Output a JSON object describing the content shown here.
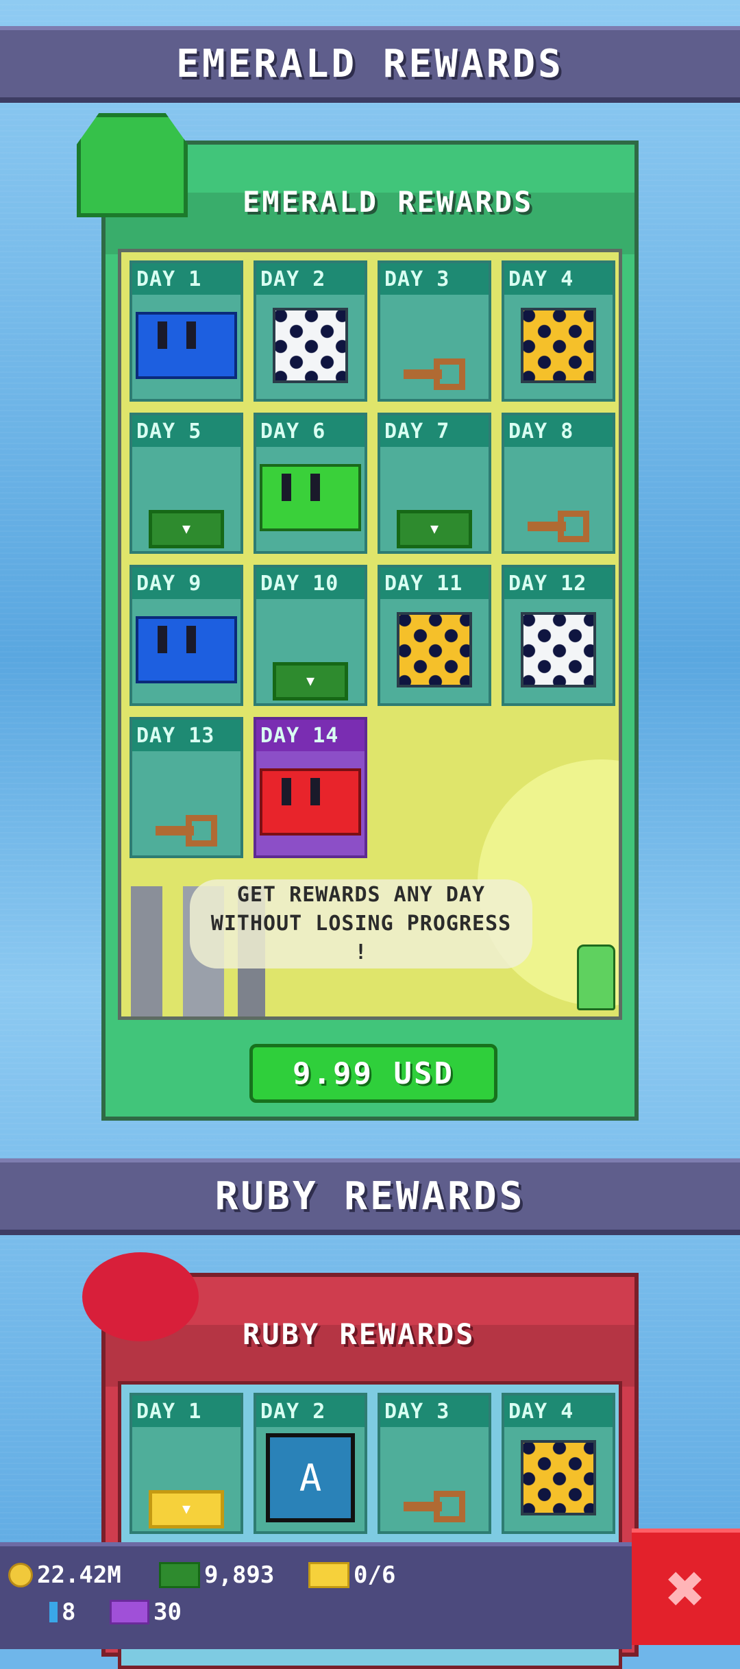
{
  "emerald_section": {
    "banner": "EMERALD REWARDS",
    "title": "EMERALD REWARDS",
    "days": [
      {
        "label": "DAY 1",
        "item": "blue-chest"
      },
      {
        "label": "DAY 2",
        "item": "white-dice"
      },
      {
        "label": "DAY 3",
        "item": "key"
      },
      {
        "label": "DAY 4",
        "item": "gold-dice"
      },
      {
        "label": "DAY 5",
        "item": "cash"
      },
      {
        "label": "DAY 6",
        "item": "green-chest"
      },
      {
        "label": "DAY 7",
        "item": "cash"
      },
      {
        "label": "DAY 8",
        "item": "key"
      },
      {
        "label": "DAY 9",
        "item": "blue-chest"
      },
      {
        "label": "DAY 10",
        "item": "cash"
      },
      {
        "label": "DAY 11",
        "item": "gold-dice"
      },
      {
        "label": "DAY 12",
        "item": "white-dice"
      },
      {
        "label": "DAY 13",
        "item": "key"
      },
      {
        "label": "DAY 14",
        "item": "red-chest"
      }
    ],
    "message": "GET REWARDS ANY DAY WITHOUT LOSING PROGRESS !",
    "price": "9.99 USD"
  },
  "ruby_section": {
    "banner": "RUBY REWARDS",
    "title": "RUBY REWARDS",
    "days": [
      {
        "label": "DAY 1",
        "item": "gold-cash"
      },
      {
        "label": "DAY 2",
        "item": "card"
      },
      {
        "label": "DAY 3",
        "item": "key"
      },
      {
        "label": "DAY 4",
        "item": "gold-dice"
      }
    ],
    "card_glyph": "A"
  },
  "hud": {
    "coins": "22.42M",
    "cash": "9,893",
    "gold_tickets": "0/6",
    "gems": "8",
    "tickets": "30"
  },
  "close_glyph": "✖",
  "colors": {
    "emerald_panel": "#41c57a",
    "ruby_panel": "#cf3d4e",
    "buy_button": "#2fcf3b",
    "close_button": "#e3212b"
  }
}
